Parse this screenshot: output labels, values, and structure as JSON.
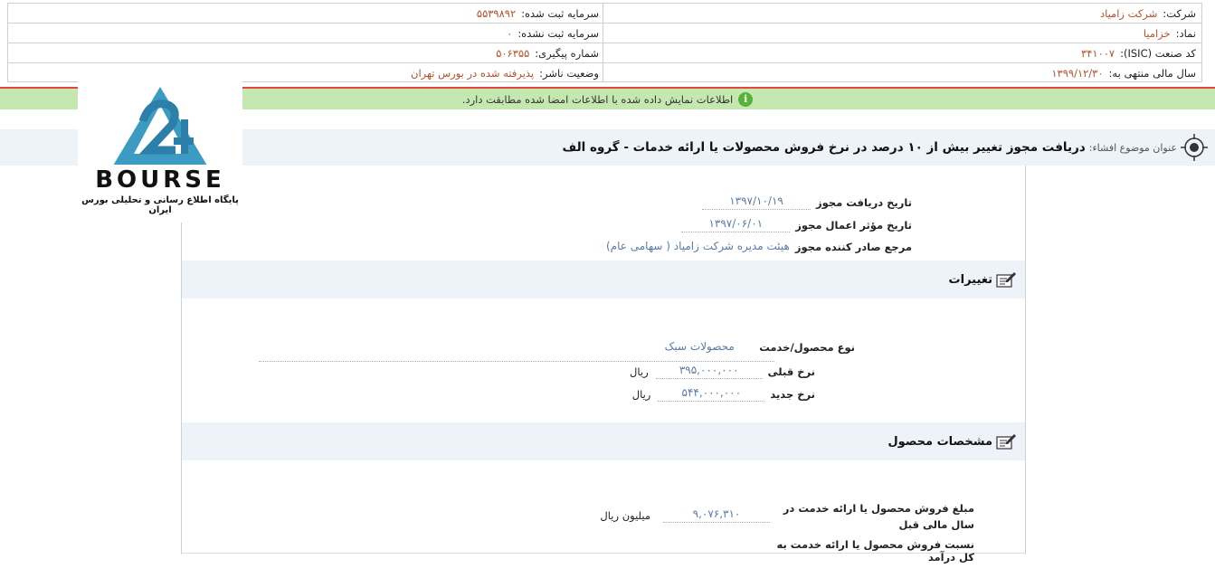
{
  "header": {
    "right": [
      {
        "key": "شرکت:",
        "value": "شرکت زامیاد"
      },
      {
        "key": "نماد:",
        "value": "خزامیا"
      },
      {
        "key": "کد صنعت (ISIC):",
        "value": "۳۴۱۰۰۷"
      },
      {
        "key": "سال مالی منتهی به:",
        "value": "۱۳۹۹/۱۲/۳۰"
      }
    ],
    "left": [
      {
        "key": "سرمایه ثبت شده:",
        "value": "۵۵۳۹۸۹۲"
      },
      {
        "key": "سرمایه ثبت نشده:",
        "value": "۰"
      },
      {
        "key": "شماره پیگیری:",
        "value": "۵۰۶۳۵۵"
      },
      {
        "key": "وضعیت ناشر:",
        "value": "پذیرفته شده در بورس تهران"
      }
    ]
  },
  "notice": {
    "text": "اطلاعات نمایش داده شده با اطلاعات امضا شده مطابقت دارد.",
    "icon": "info-icon"
  },
  "logo": {
    "brand": "BOURSE",
    "tagline": "پایگاه اطلاع رسانی و تحلیلی بورس ایران"
  },
  "title": {
    "label": "عنوان موضوع افشاء:",
    "text": "دریافت مجوز تغییر بیش از ۱۰ درصد در نرخ فروش محصولات یا ارائه خدمات - گروه الف"
  },
  "permit": {
    "receive_date_label": "تاریخ دریافت مجوز",
    "receive_date": "۱۳۹۷/۱۰/۱۹",
    "effective_date_label": "تاریخ مؤثر اعمال مجوز",
    "effective_date": "۱۳۹۷/۰۶/۰۱",
    "issuer_label": "مرجع صادر کننده مجوز",
    "issuer": "هیئت مدیره شرکت زامیاد ( سهامی عام)"
  },
  "changes": {
    "title": "تغییرات",
    "product_type_label": "نوع محصول/خدمت",
    "product_type": "محصولات سبک",
    "old_price_label": "نرخ قبلی",
    "old_price": "۳۹۵,۰۰۰,۰۰۰",
    "old_price_unit": "ریال",
    "new_price_label": "نرخ جدید",
    "new_price": "۵۴۴,۰۰۰,۰۰۰",
    "new_price_unit": "ریال"
  },
  "specs": {
    "title": "مشخصات محصول",
    "sales_label": "مبلغ فروش محصول یا ارائه خدمت در سال مالی قبل",
    "sales_value": "۹,۰۷۶,۳۱۰",
    "sales_unit": "میلیون ریال",
    "ratio_label": "نسبت فروش محصول یا ارائه خدمت به کل درآمد"
  },
  "colors": {
    "accent": "#b6502a",
    "link": "#5a7ba8",
    "notice_bg": "#c5e8b0",
    "bar_bg": "#eef3f9",
    "red_line": "#e0483e"
  }
}
